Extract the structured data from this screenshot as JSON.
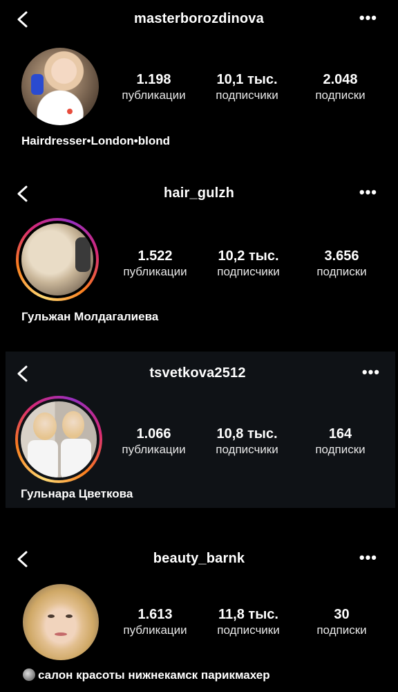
{
  "profiles": [
    {
      "username": "masterborozdinova",
      "stats": [
        {
          "value": "1.198",
          "label": "публикации"
        },
        {
          "value": "10,1 тыс.",
          "label": "подписчики"
        },
        {
          "value": "2.048",
          "label": "подписки"
        }
      ],
      "bio": "Hairdresser•London•blond",
      "has_story_ring": false
    },
    {
      "username": "hair_gulzh",
      "stats": [
        {
          "value": "1.522",
          "label": "публикации"
        },
        {
          "value": "10,2 тыс.",
          "label": "подписчики"
        },
        {
          "value": "3.656",
          "label": "подписки"
        }
      ],
      "bio": "Гульжан Молдагалиева",
      "has_story_ring": true
    },
    {
      "username": "tsvetkova2512",
      "stats": [
        {
          "value": "1.066",
          "label": "публикации"
        },
        {
          "value": "10,8 тыс.",
          "label": "подписчики"
        },
        {
          "value": "164",
          "label": "подписки"
        }
      ],
      "bio": "Гульнара Цветкова",
      "has_story_ring": true
    },
    {
      "username": "beauty_barnk",
      "stats": [
        {
          "value": "1.613",
          "label": "публикации"
        },
        {
          "value": "11,8 тыс.",
          "label": "подписчики"
        },
        {
          "value": "30",
          "label": "подписки"
        }
      ],
      "bio": "салон красоты нижнекамск парикмахер",
      "has_story_ring": false
    }
  ],
  "icons": {
    "back": "chevron-left-icon",
    "more": "more-dots-icon",
    "bio_emoji": "moon-icon"
  },
  "more_glyph": "•••",
  "colors": {
    "background": "#000000",
    "alt_card_background": "#0f1216",
    "text": "#ffffff"
  }
}
